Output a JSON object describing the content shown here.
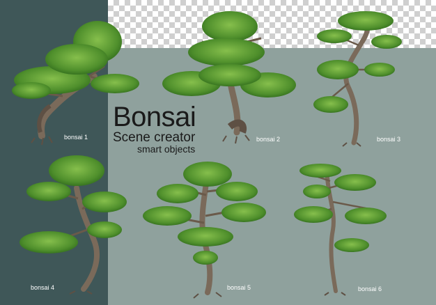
{
  "colors": {
    "left_panel": "#3f5758",
    "right_panel": "#8fa19d",
    "foliage": "#4a8a2a",
    "foliage_light": "#7cb347",
    "trunk": "#7a6a5a"
  },
  "heading": {
    "title": "Bonsai",
    "subtitle": "Scene creator",
    "tagline": "smart objects"
  },
  "labels": {
    "b1": "bonsai 1",
    "b2": "bonsai 2",
    "b3": "bonsai 3",
    "b4": "bonsai 4",
    "b5": "bonsai 5",
    "b6": "bonsai 6"
  }
}
